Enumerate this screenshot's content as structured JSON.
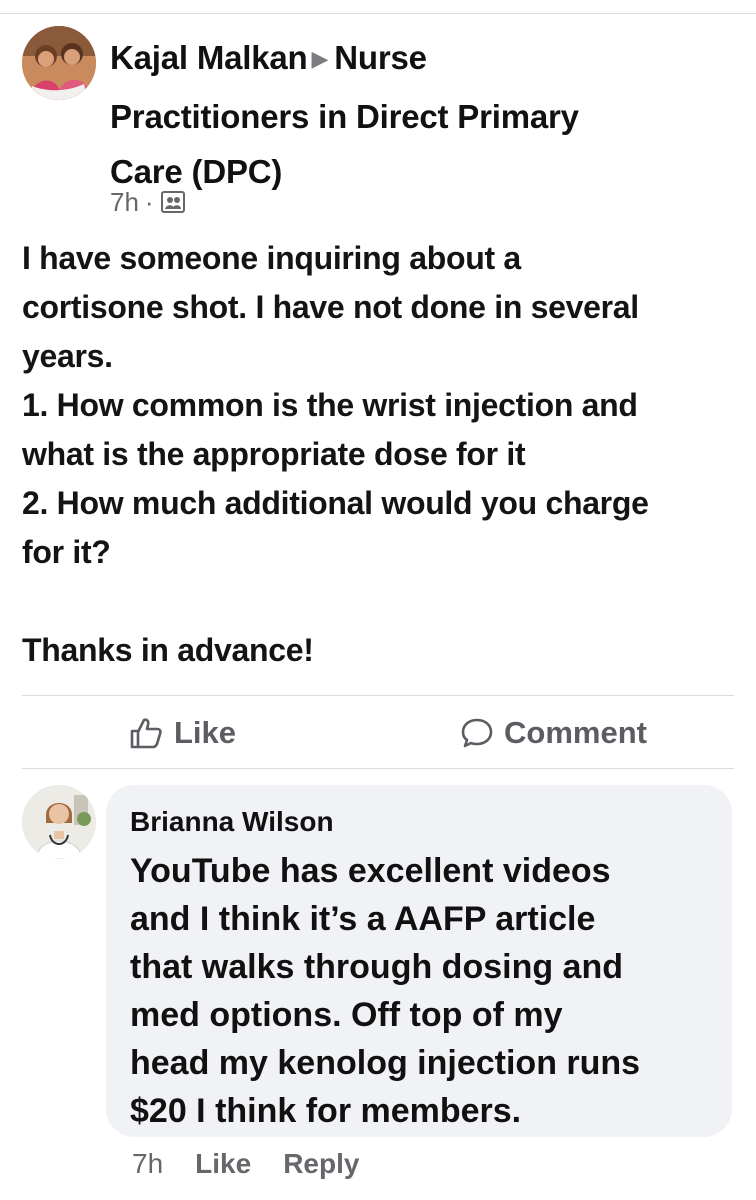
{
  "post": {
    "author": "Kajal Malkan",
    "group": "Nurse Practitioners in Direct Primary Care (DPC)",
    "header_lines": [
      "Practitioners in Direct Primary",
      "Care (DPC)"
    ],
    "group_first_word": "Nurse",
    "time": "7h",
    "audience_icon": "group-icon",
    "body_lines": [
      "I have someone inquiring about a",
      "cortisone shot. I have not done in several",
      "years.",
      "1. How common is the wrist injection and",
      "what is the appropriate dose for it",
      "2. How much additional would you charge",
      "for it?",
      "",
      "Thanks in advance!"
    ]
  },
  "actions": {
    "like_label": "Like",
    "comment_label": "Comment"
  },
  "comment": {
    "author": "Brianna Wilson",
    "text_lines": [
      "YouTube has excellent videos",
      "and I think it’s a AAFP article",
      "that walks through dosing and",
      "med options. Off top of my",
      "head my kenolog injection runs",
      "$20 I think for members."
    ],
    "time": "7h",
    "like_label": "Like",
    "reply_label": "Reply"
  },
  "colors": {
    "text": "#111111",
    "secondary": "#65676b",
    "bubble": "#f0f2f5",
    "divider": "#dcdde1"
  }
}
